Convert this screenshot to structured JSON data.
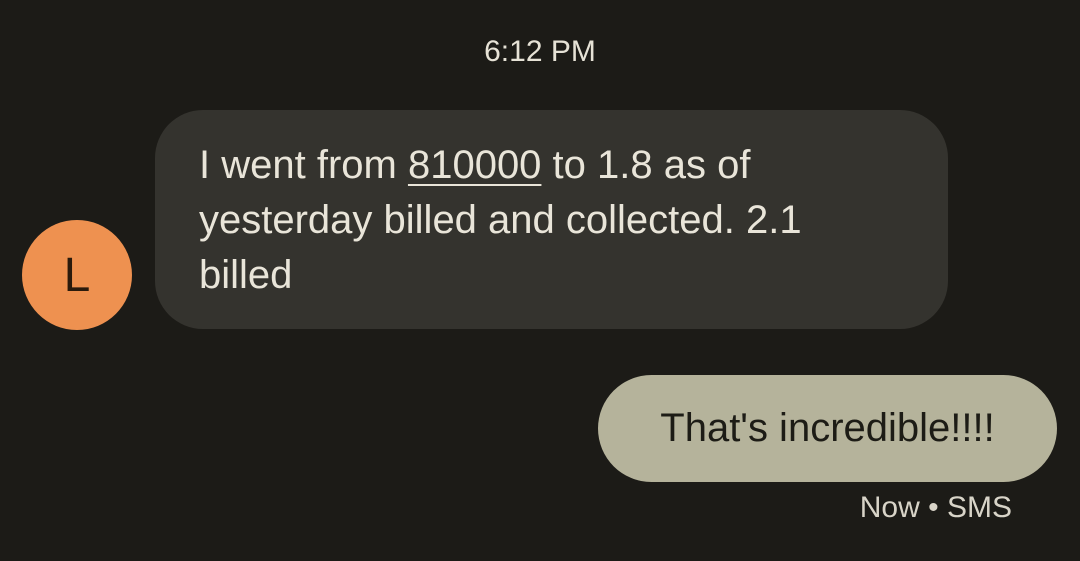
{
  "conversation": {
    "timestamp": "6:12 PM",
    "incoming": {
      "avatar_letter": "L",
      "avatar_color": "#ee9150",
      "text_before_link": "I went from ",
      "link_text": "810000",
      "text_after_link": " to 1.8 as of yesterday billed and collected. 2.1 billed"
    },
    "outgoing": {
      "text": "That's incredible!!!!",
      "status": "Now",
      "separator": "•",
      "channel": "SMS"
    }
  },
  "colors": {
    "background": "#1c1b17",
    "incoming_bubble": "#34332e",
    "outgoing_bubble": "#b5b39b"
  }
}
